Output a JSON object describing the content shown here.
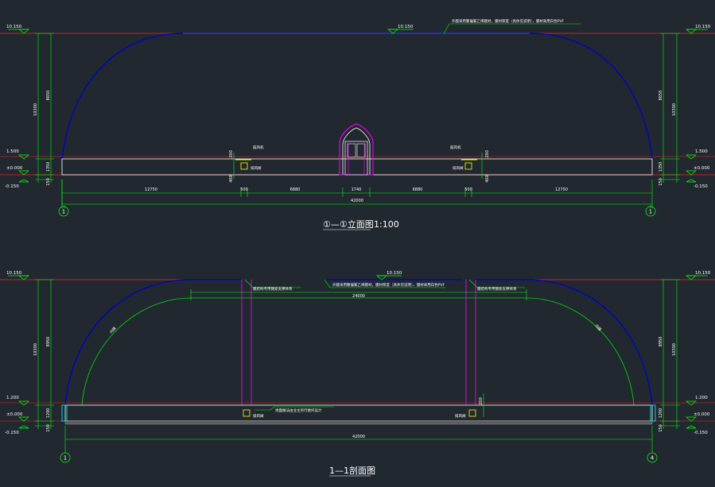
{
  "colors": {
    "background": "#212830",
    "dimension": "#00ff00",
    "level_line": "#ff2020",
    "outline": "#ffffff",
    "arch": "#0000c8",
    "inner_arch": "#00e000",
    "door_frame": "#ff00ff",
    "equipment": "#ffff00",
    "skirt": "#00ffff"
  },
  "elevation": {
    "title": "①—①立面图",
    "scale": "1:100",
    "levels": {
      "top_left": "10.150",
      "top_mid": "10.150",
      "top_right": "10.150",
      "l1500_left": "1.500",
      "l1500_right": "1.500",
      "zero_left": "±0.000",
      "zero_right": "±0.000",
      "neg_left": "-0.150",
      "neg_right": "-0.150"
    },
    "vertical_dims": {
      "total_left": "10300",
      "total_right": "10300",
      "arch_left": "8650",
      "arch_right": "8650",
      "base_left": "1350",
      "base_right": "1350",
      "foot_left": "150",
      "foot_right": "150",
      "equip_upper_left": "200",
      "equip_lower_left": "400",
      "equip_upper_right": "200",
      "equip_lower_right": "400"
    },
    "horizontal_dims": [
      "12750",
      "500",
      "6880",
      "1740",
      "6880",
      "500",
      "12750"
    ],
    "total_width": "42000",
    "labels": {
      "roof_note": "外膜采用聚偏氟乙烯膜材，膜材厚度（具体见说明），膜材采用白色PVF",
      "fan_left": "鼓风机",
      "fan_right": "鼓风机",
      "vent_left": "排风阀",
      "vent_right": "排风阀"
    },
    "axes": [
      "1",
      "1"
    ]
  },
  "section": {
    "title": "1—1剖面图",
    "levels": {
      "top_left": "10.150",
      "top_mid": "10.150",
      "top_right": "10.150",
      "l1200_left": "1.200",
      "l1200_right": "1.200",
      "zero_left": "±0.000",
      "zero_right": "±0.000",
      "neg_left": "-0.150",
      "neg_right": "-0.150"
    },
    "vertical_dims": {
      "total_left": "10300",
      "total_right": "10300",
      "arch_left": "8950",
      "arch_right": "8950",
      "base_left": "1200",
      "base_right": "1200",
      "foot_left": "150",
      "foot_right": "150",
      "equip_right": "200"
    },
    "inner_span": "24000",
    "total_width": "42000",
    "labels": {
      "roof_note": "外膜采用聚偏氟乙烯膜材，膜材厚度（具体见说明），膜材采用白色PVF",
      "support_left": "膜结构专用钢索支撑体系",
      "support_right": "膜结构专用钢索支撑体系",
      "arch_left": "内膜",
      "arch_right": "内膜",
      "foundation": "地面做法由业主另行委托设计",
      "vent_left": "排风阀",
      "vent_right": "排风阀"
    },
    "axes": [
      "1",
      "4"
    ]
  }
}
